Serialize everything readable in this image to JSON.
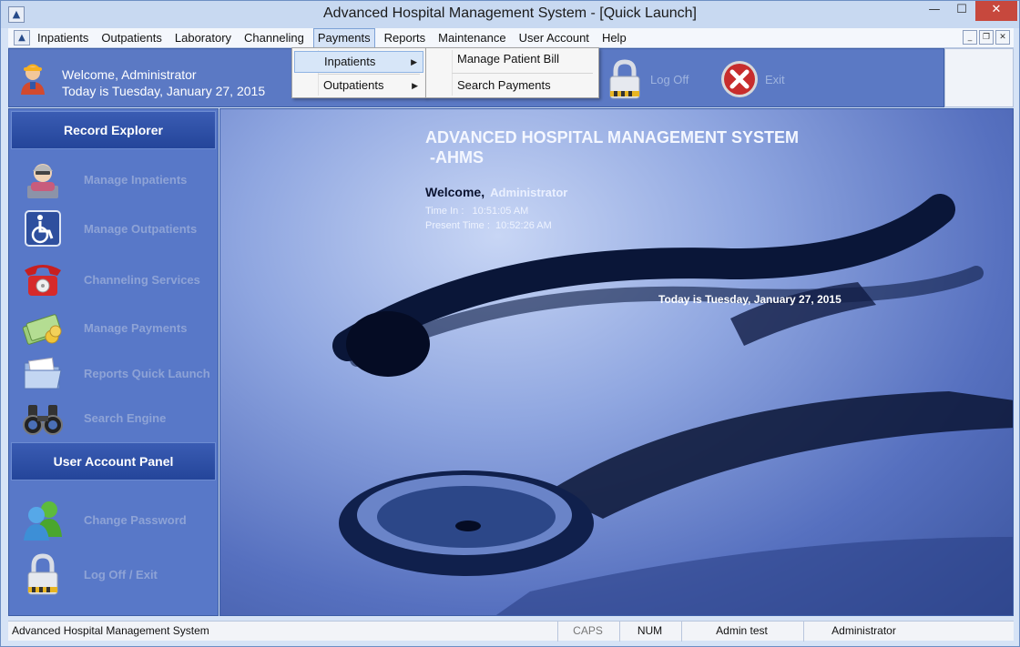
{
  "window": {
    "title": "Advanced Hospital Management System - [Quick Launch]",
    "app_icon_glyph": "▲",
    "min_glyph": "—",
    "max_glyph": "☐",
    "close_glyph": "✕"
  },
  "menu": {
    "items": [
      "Inpatients",
      "Outpatients",
      "Laboratory",
      "Channeling",
      "Payments",
      "Reports",
      "Maintenance",
      "User Account",
      "Help"
    ],
    "active": "Payments",
    "mdi_min": "_",
    "mdi_restore": "❐",
    "mdi_close": "✕"
  },
  "payments_menu": {
    "items": [
      {
        "label": "Inpatients",
        "arrow": "▶"
      },
      {
        "label": "Outpatients",
        "arrow": "▶"
      }
    ],
    "submenu": [
      "Manage Patient Bill",
      "Search Payments"
    ]
  },
  "header": {
    "welcome": "Welcome, Administrator",
    "today": "Today is Tuesday, January 27, 2015",
    "logoff_label": "Log Off",
    "exit_label": "Exit"
  },
  "sidebar": {
    "record_explorer": "Record Explorer",
    "records": [
      {
        "label": "Manage Inpatients",
        "icon": "nurse-icon"
      },
      {
        "label": "Manage Outpatients",
        "icon": "wheelchair-icon"
      },
      {
        "label": "Channeling Services",
        "icon": "telephone-icon"
      },
      {
        "label": "Manage Payments",
        "icon": "money-icon"
      },
      {
        "label": "Reports Quick Launch",
        "icon": "folder-icon"
      },
      {
        "label": "Search Engine",
        "icon": "binoculars-icon"
      }
    ],
    "user_panel": "User Account Panel",
    "user_items": [
      {
        "label": "Change Password",
        "icon": "users-icon"
      },
      {
        "label": "Log Off / Exit",
        "icon": "padlock-icon"
      }
    ]
  },
  "main": {
    "title_line1": "ADVANCED HOSPITAL MANAGEMENT SYSTEM",
    "title_line2": " -AHMS",
    "welcome_label": "Welcome,",
    "welcome_user": "Administrator",
    "time_in": "Time In :   10:51:05 AM",
    "present_time": "Present Time :  10:52:26 AM",
    "today": "Today is Tuesday, January 27, 2015"
  },
  "status": {
    "app": "Advanced Hospital Management System",
    "caps": "CAPS",
    "num": "NUM",
    "user": "Admin test",
    "role": "Administrator"
  },
  "colors": {
    "header_blue": "#5b79c4",
    "panel_head": "#24459a",
    "close_red": "#c7483d"
  }
}
